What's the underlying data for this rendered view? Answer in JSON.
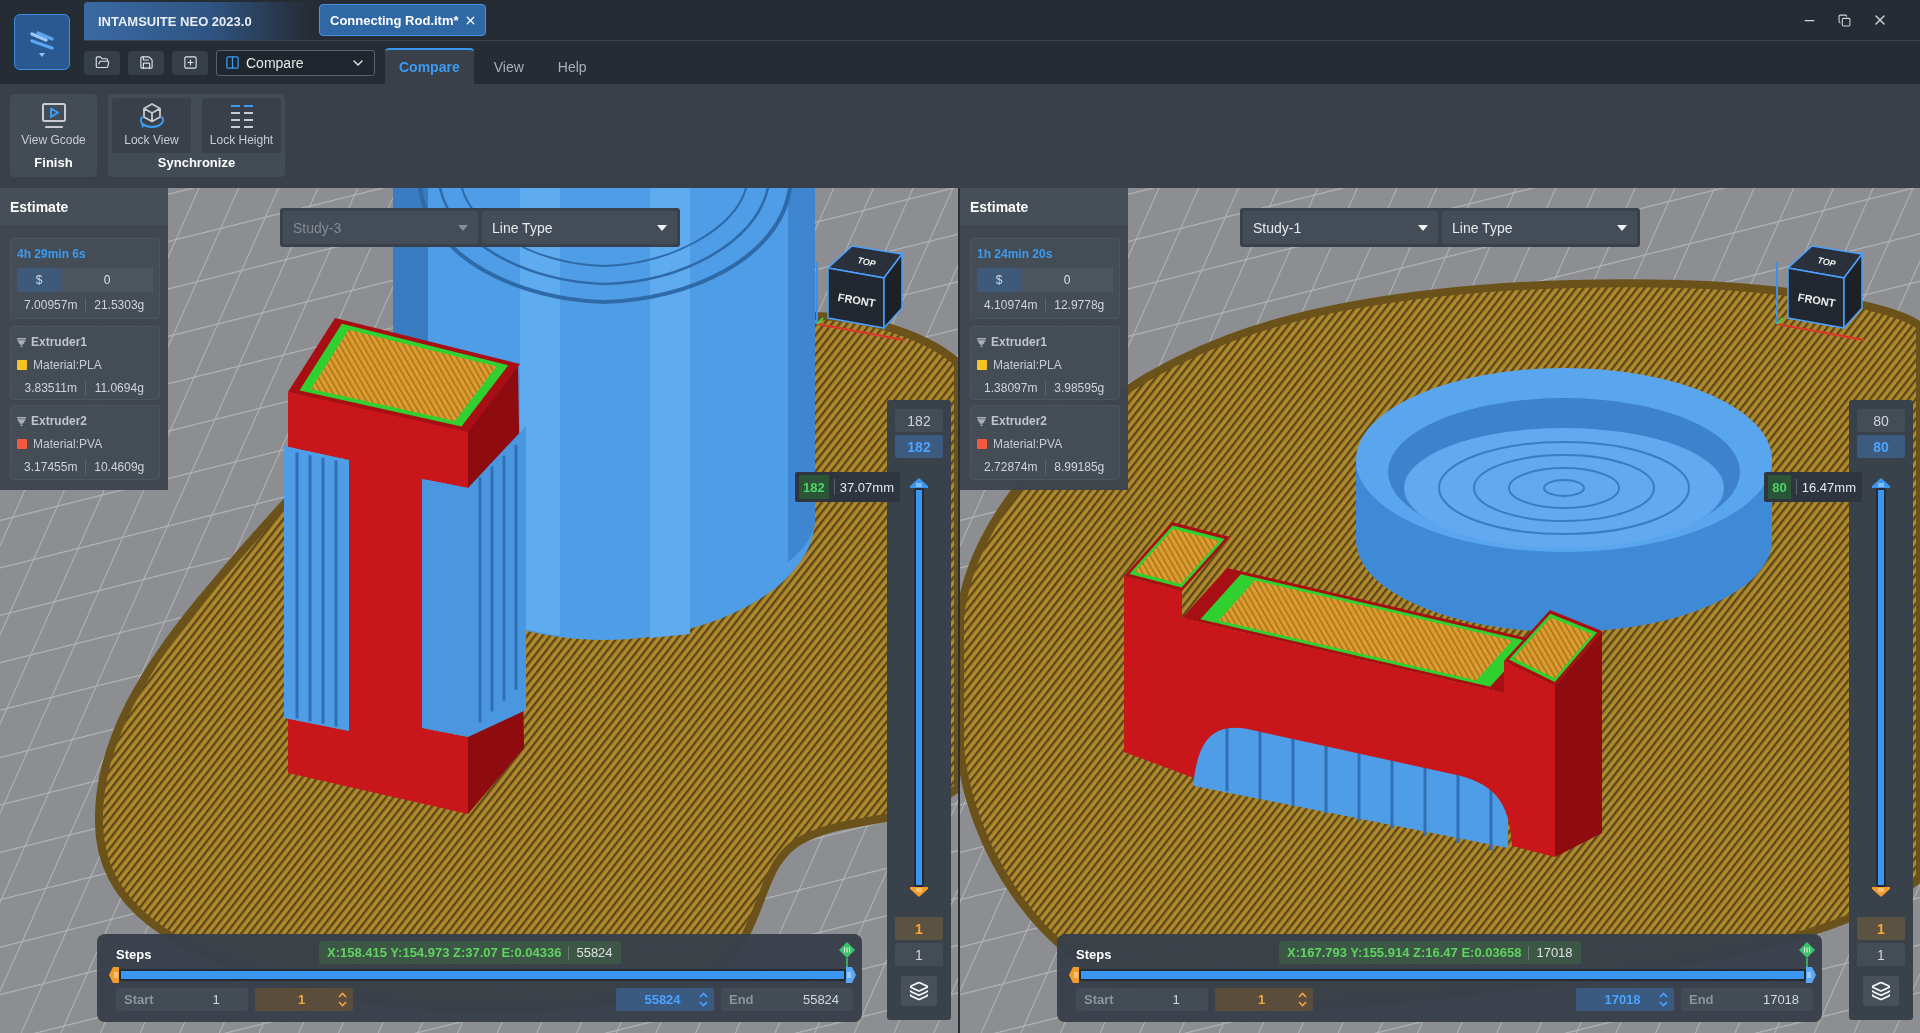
{
  "app": {
    "title": "INTAMSUITE NEO 2023.0"
  },
  "document_tab": {
    "label": "Connecting Rod.itm*"
  },
  "mode_select": {
    "value": "Compare"
  },
  "menu_tabs": [
    {
      "label": "Compare",
      "selected": true
    },
    {
      "label": "View",
      "selected": false
    },
    {
      "label": "Help",
      "selected": false
    }
  ],
  "ribbon_groups": [
    {
      "title": "Finish",
      "buttons": [
        {
          "label": "View Gcode"
        }
      ]
    },
    {
      "title": "Synchronize",
      "buttons": [
        {
          "label": "Lock View"
        },
        {
          "label": "Lock Height"
        }
      ]
    }
  ],
  "viewports": [
    {
      "preview": {
        "kind": "standing"
      },
      "estimate": {
        "title": "Estimate",
        "time": "4h 29min 6s",
        "cost_symbol": "$",
        "cost": "0",
        "length": "7.00957m",
        "weight": "21.5303g",
        "extruders": [
          {
            "name": "Extruder1",
            "material": "Material:PLA",
            "color": "#f6c523",
            "length": "3.83511m",
            "weight": "11.0694g"
          },
          {
            "name": "Extruder2",
            "material": "Material:PVA",
            "color": "#f4573b",
            "length": "3.17455m",
            "weight": "10.4609g"
          }
        ]
      },
      "selects": [
        {
          "value": "Study-3",
          "disabled": true
        },
        {
          "value": "Line Type",
          "disabled": false
        }
      ],
      "view_cube": {
        "top": "TOP",
        "front": "FRONT"
      },
      "layer_slider": {
        "max": "182",
        "upper": "182",
        "lower": "1",
        "min": "1",
        "level": 1
      },
      "layer_tooltip": {
        "layer": "182",
        "height": "37.07mm"
      },
      "steps": {
        "title": "Steps",
        "position": "X:158.415 Y:154.973 Z:37.07 E:0.04336",
        "step": "55824",
        "level": 1,
        "start_label": "Start",
        "start_min": "1",
        "start_value": "1",
        "end_value": "55824",
        "end_label": "End",
        "end_max": "55824"
      }
    },
    {
      "preview": {
        "kind": "lying"
      },
      "estimate": {
        "title": "Estimate",
        "time": "1h 24min 20s",
        "cost_symbol": "$",
        "cost": "0",
        "length": "4.10974m",
        "weight": "12.9778g",
        "extruders": [
          {
            "name": "Extruder1",
            "material": "Material:PLA",
            "color": "#f6c523",
            "length": "1.38097m",
            "weight": "3.98595g"
          },
          {
            "name": "Extruder2",
            "material": "Material:PVA",
            "color": "#f4573b",
            "length": "2.72874m",
            "weight": "8.99185g"
          }
        ]
      },
      "selects": [
        {
          "value": "Study-1",
          "disabled": false
        },
        {
          "value": "Line Type",
          "disabled": false
        }
      ],
      "view_cube": {
        "top": "TOP",
        "front": "FRONT"
      },
      "layer_slider": {
        "max": "80",
        "upper": "80",
        "lower": "1",
        "min": "1",
        "level": 1
      },
      "layer_tooltip": {
        "layer": "80",
        "height": "16.47mm"
      },
      "steps": {
        "title": "Steps",
        "position": "X:167.793 Y:155.914 Z:16.47 E:0.03658",
        "step": "17018",
        "level": 1,
        "start_label": "Start",
        "start_min": "1",
        "start_value": "1",
        "end_value": "17018",
        "end_label": "End",
        "end_max": "17018"
      }
    }
  ]
}
